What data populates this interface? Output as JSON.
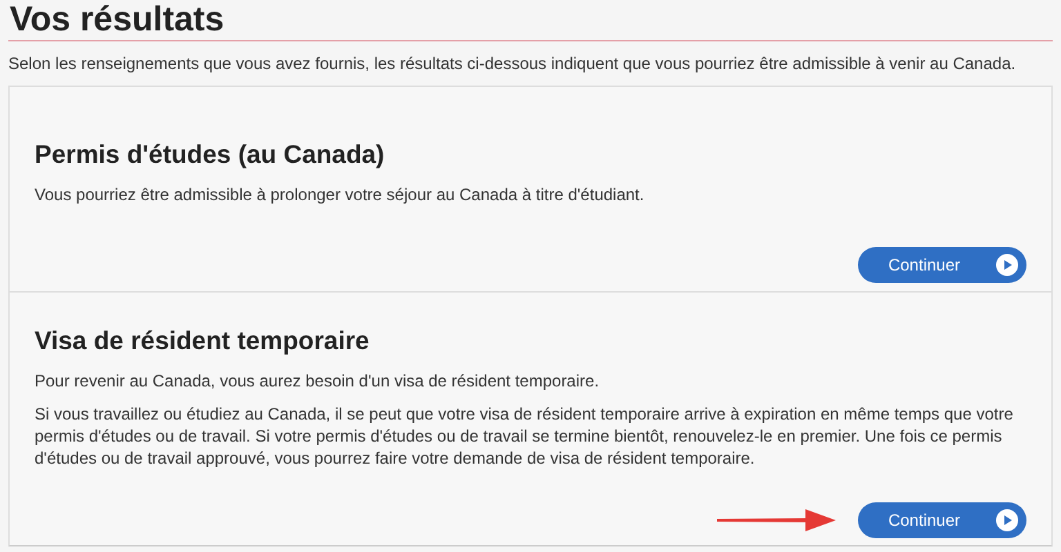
{
  "page": {
    "title": "Vos résultats",
    "intro": "Selon les renseignements que vous avez fournis, les résultats ci-dessous indiquent que vous pourriez être admissible à venir au Canada."
  },
  "results": [
    {
      "title": "Permis d'études (au Canada)",
      "paragraphs": [
        "Vous pourriez être admissible à prolonger votre séjour au Canada à titre d'étudiant."
      ],
      "button": "Continuer",
      "pointed_at": false
    },
    {
      "title": "Visa de résident temporaire",
      "paragraphs": [
        "Pour revenir au Canada, vous aurez besoin d'un visa de résident temporaire.",
        "Si vous travaillez ou étudiez au Canada, il se peut que votre visa de résident temporaire arrive à expiration en même temps que votre permis d'études ou de travail. Si votre permis d'études ou de travail se termine bientôt, renouvelez-le en premier. Une fois ce permis d'études ou de travail approuvé, vous pourrez faire votre demande de visa de résident temporaire."
      ],
      "button": "Continuer",
      "pointed_at": true
    }
  ]
}
